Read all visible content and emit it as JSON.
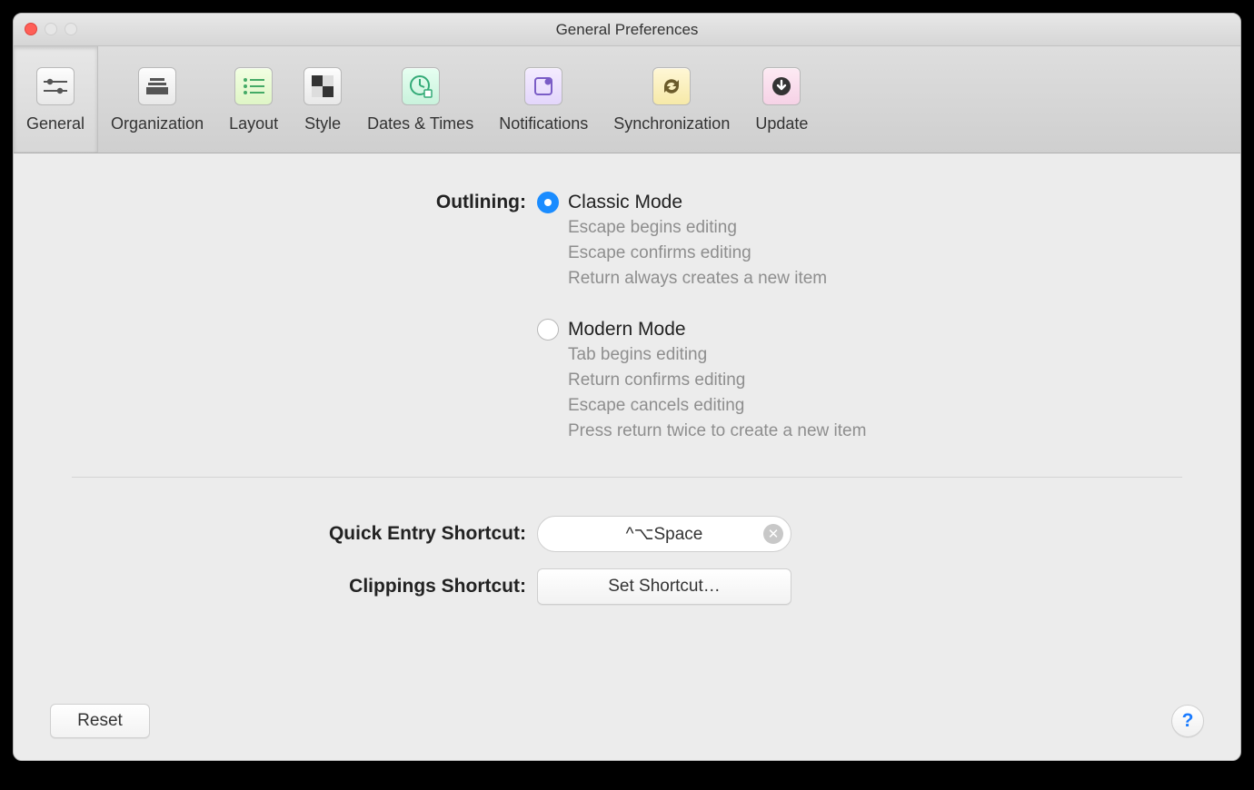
{
  "window": {
    "title": "General Preferences"
  },
  "toolbar": {
    "items": [
      {
        "label": "General"
      },
      {
        "label": "Organization"
      },
      {
        "label": "Layout"
      },
      {
        "label": "Style"
      },
      {
        "label": "Dates & Times"
      },
      {
        "label": "Notifications"
      },
      {
        "label": "Synchronization"
      },
      {
        "label": "Update"
      }
    ],
    "selected_index": 0
  },
  "outlining": {
    "label": "Outlining:",
    "classic": {
      "title": "Classic Mode",
      "lines": [
        "Escape begins editing",
        "Escape confirms editing",
        "Return always creates a new item"
      ]
    },
    "modern": {
      "title": "Modern Mode",
      "lines": [
        "Tab begins editing",
        "Return confirms editing",
        "Escape cancels editing",
        "Press return twice to create a new item"
      ]
    },
    "selected": "classic"
  },
  "shortcuts": {
    "quick_entry_label": "Quick Entry Shortcut:",
    "quick_entry_value": "^⌥Space",
    "clippings_label": "Clippings Shortcut:",
    "clippings_value": "Set Shortcut…"
  },
  "footer": {
    "reset_label": "Reset",
    "help_label": "?"
  }
}
